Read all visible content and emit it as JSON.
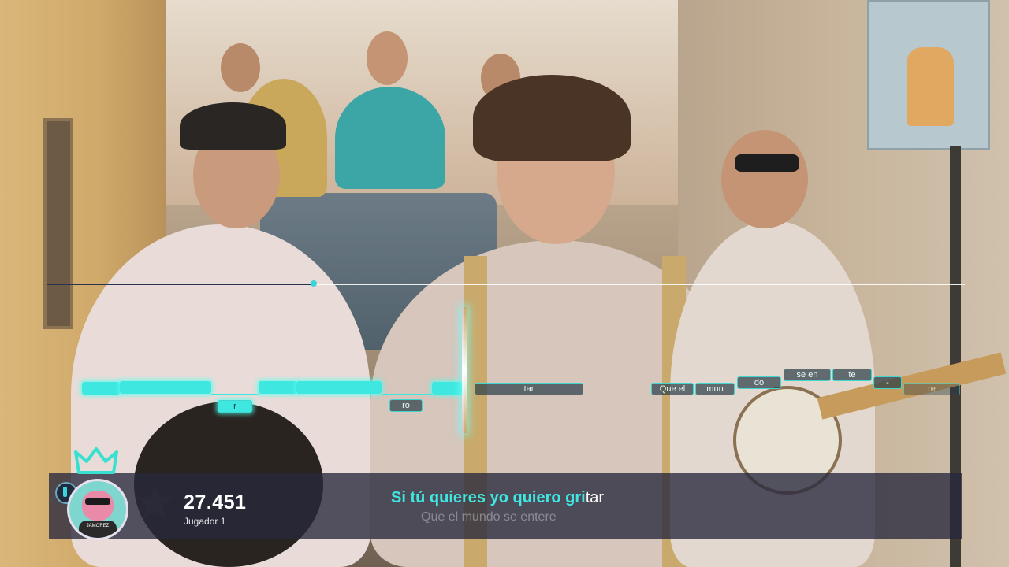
{
  "hud": {
    "score": "27.451",
    "player_name": "Jugador 1",
    "avatar_tag": "JAMOREZ",
    "song_progress": 0.29
  },
  "lyrics": {
    "current_sung": "Si tú quieres yo quiero gri",
    "current_unsung": "tar",
    "next_line": "Que el mundo se entere"
  },
  "notes": {
    "n1": "r",
    "n2": "ro",
    "n3": "tar",
    "n4": "Que el",
    "n5": "mun",
    "n6": "do",
    "n7": "se en",
    "n8": "te",
    "n9": "-",
    "n10": "re"
  },
  "colors": {
    "accent": "#3ee8e0",
    "bar": "#28283c",
    "crown": "#38e0d0"
  },
  "icons": {
    "crown": "crown-icon",
    "star": "star-icon",
    "player": "player-badge-icon"
  }
}
